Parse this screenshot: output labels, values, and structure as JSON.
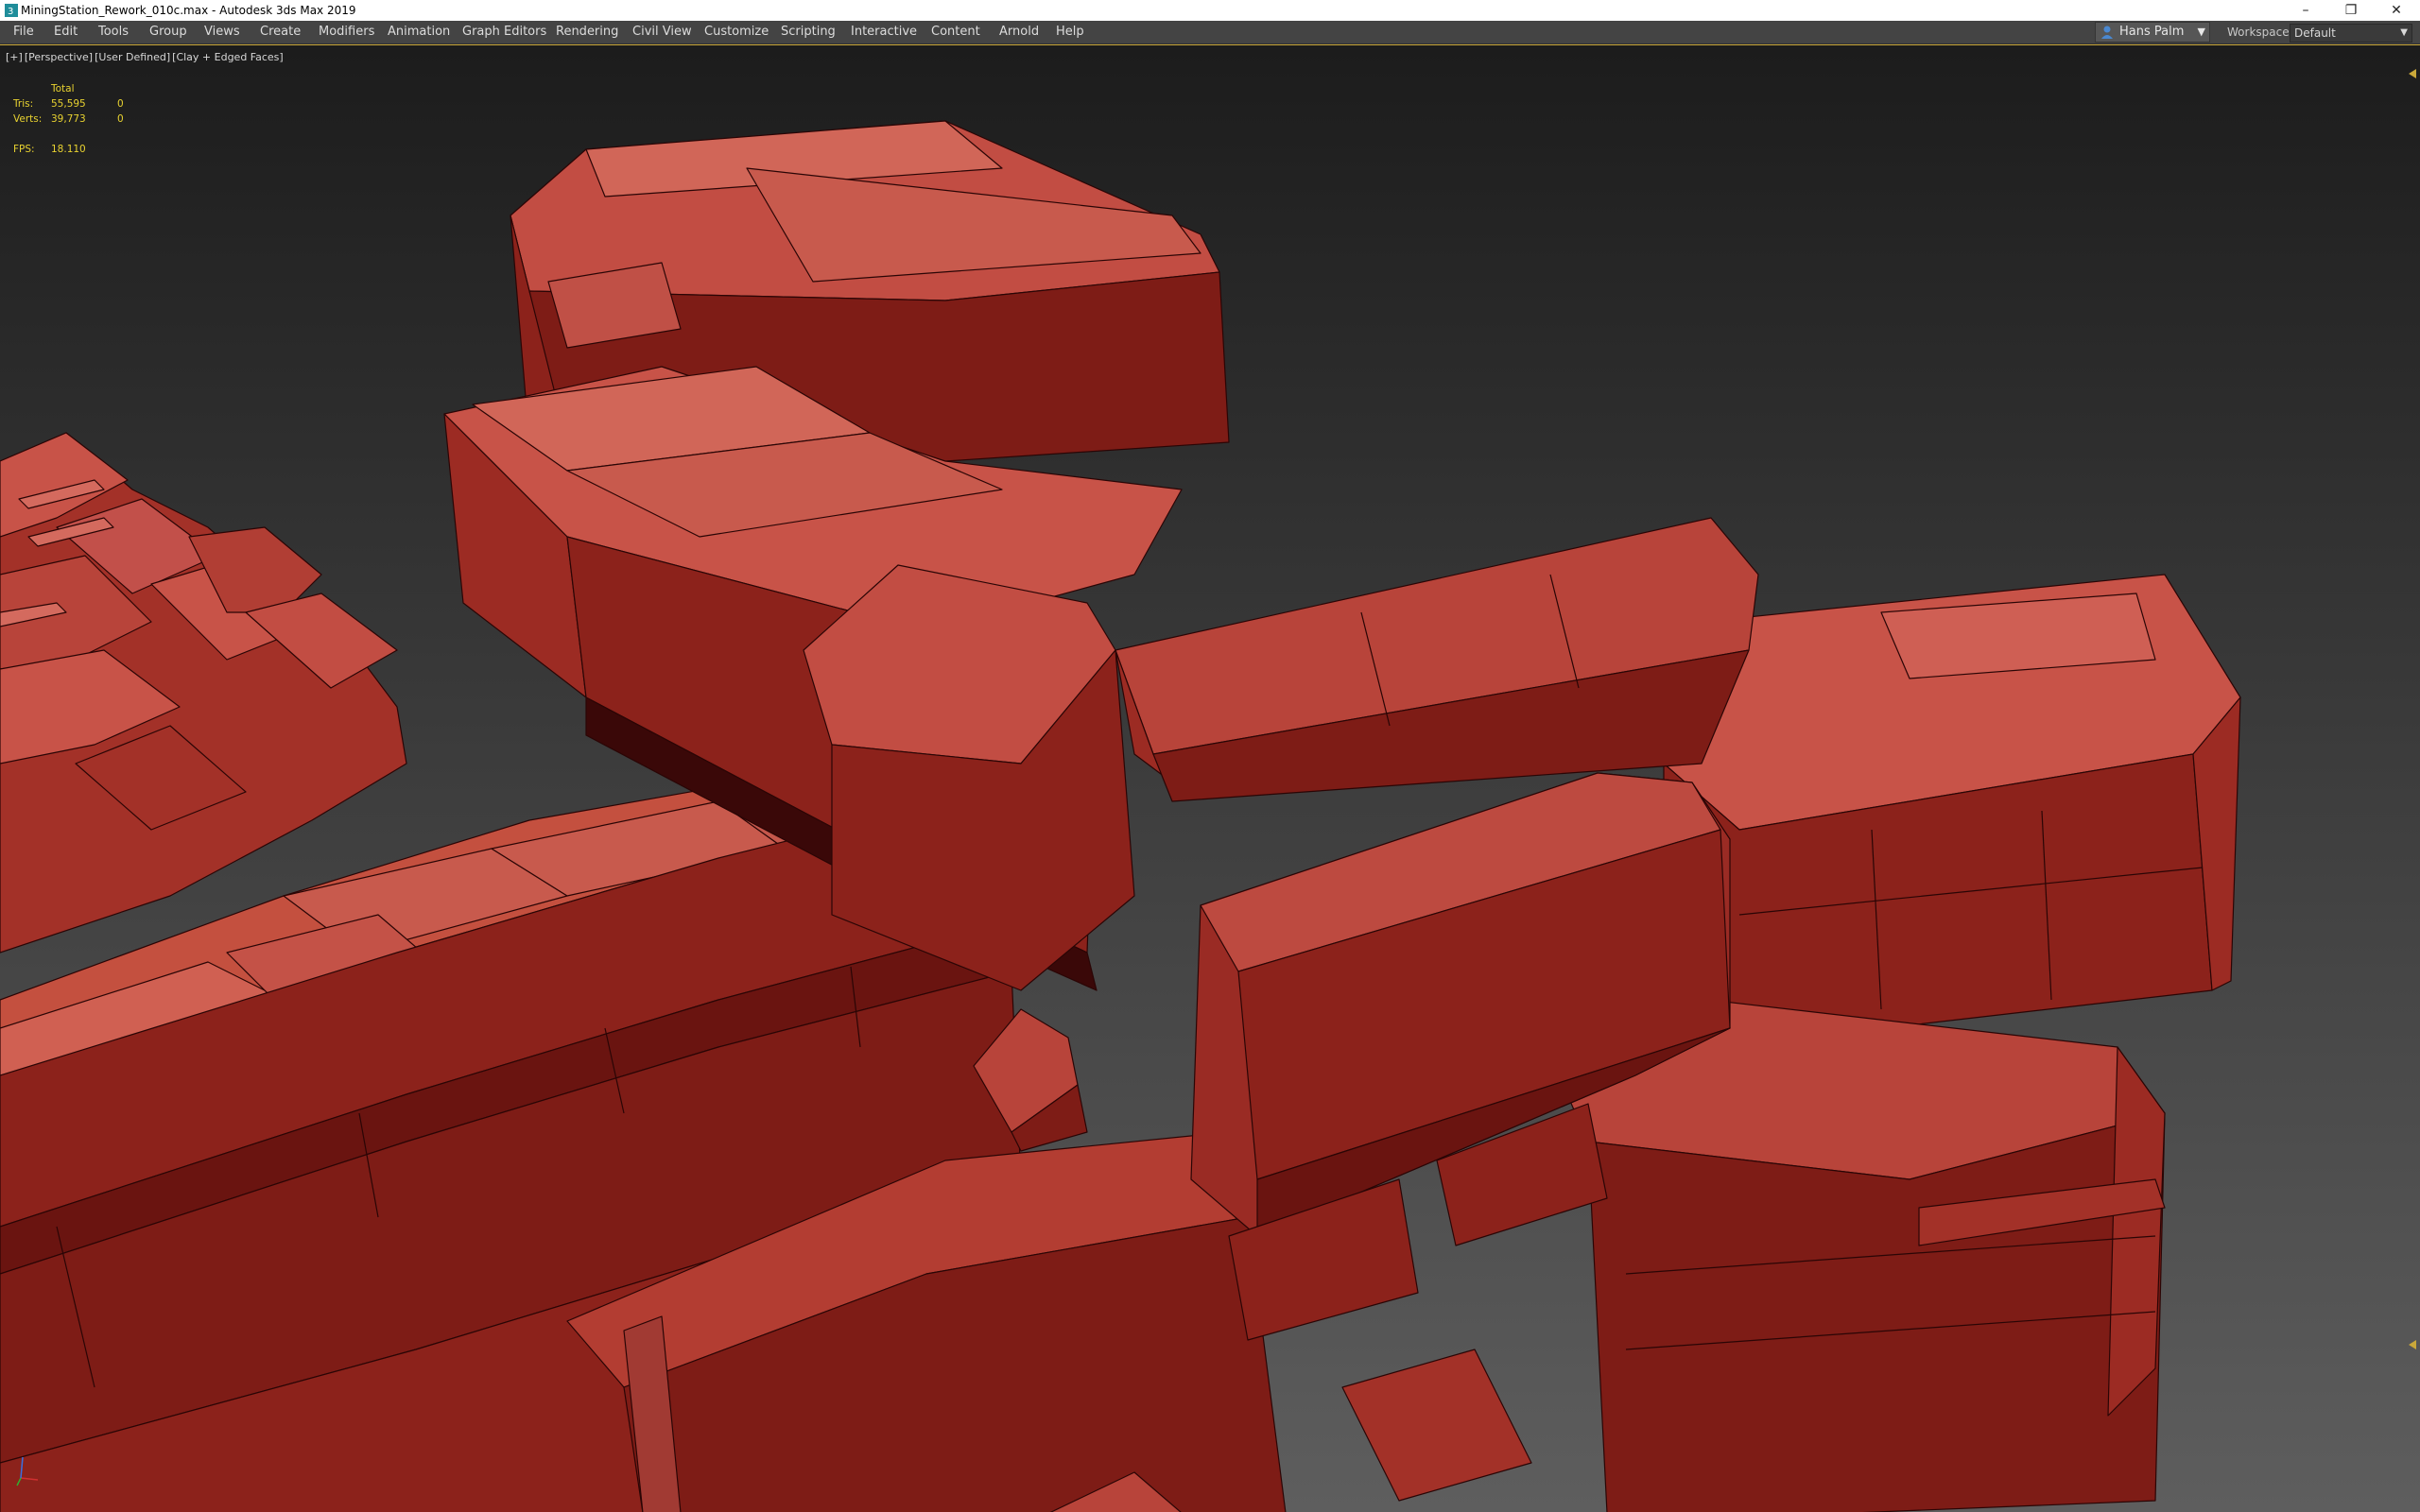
{
  "window": {
    "title": "MiningStation_Rework_010c.max - Autodesk 3ds Max 2019",
    "icon": "3dsmax-app-icon",
    "controls": [
      "minimize",
      "restore",
      "close"
    ]
  },
  "menu": {
    "items": [
      "File",
      "Edit",
      "Tools",
      "Group",
      "Views",
      "Create",
      "Modifiers",
      "Animation",
      "Graph Editors",
      "Rendering",
      "Civil View",
      "Customize",
      "Scripting",
      "Interactive",
      "Content",
      "Arnold",
      "Help"
    ]
  },
  "user": {
    "name": "Hans Palm",
    "icon": "user-icon"
  },
  "workspaces": {
    "label": "Workspaces:",
    "value": "Default"
  },
  "viewport": {
    "label_plus": "[+]",
    "label_view": "[Perspective]",
    "label_shading": "[User Defined]",
    "label_mode": "[Clay + Edged Faces]",
    "stats": {
      "header": "Total",
      "tris_label": "Tris:",
      "tris_total": "55,595",
      "tris_sel": "0",
      "verts_label": "Verts:",
      "verts_total": "39,773",
      "verts_sel": "0",
      "fps_label": "FPS:",
      "fps_value": "18.110"
    }
  },
  "colors": {
    "clay_light": "#c8584d",
    "clay_mid": "#a8372f",
    "clay_dark": "#7a1d18",
    "clay_shadow": "#3a0808",
    "bg_top": "#1e1e1e",
    "bg_bottom": "#5a5a5a",
    "stats_yellow": "#e8d230",
    "viewport_border": "#caa83a"
  }
}
